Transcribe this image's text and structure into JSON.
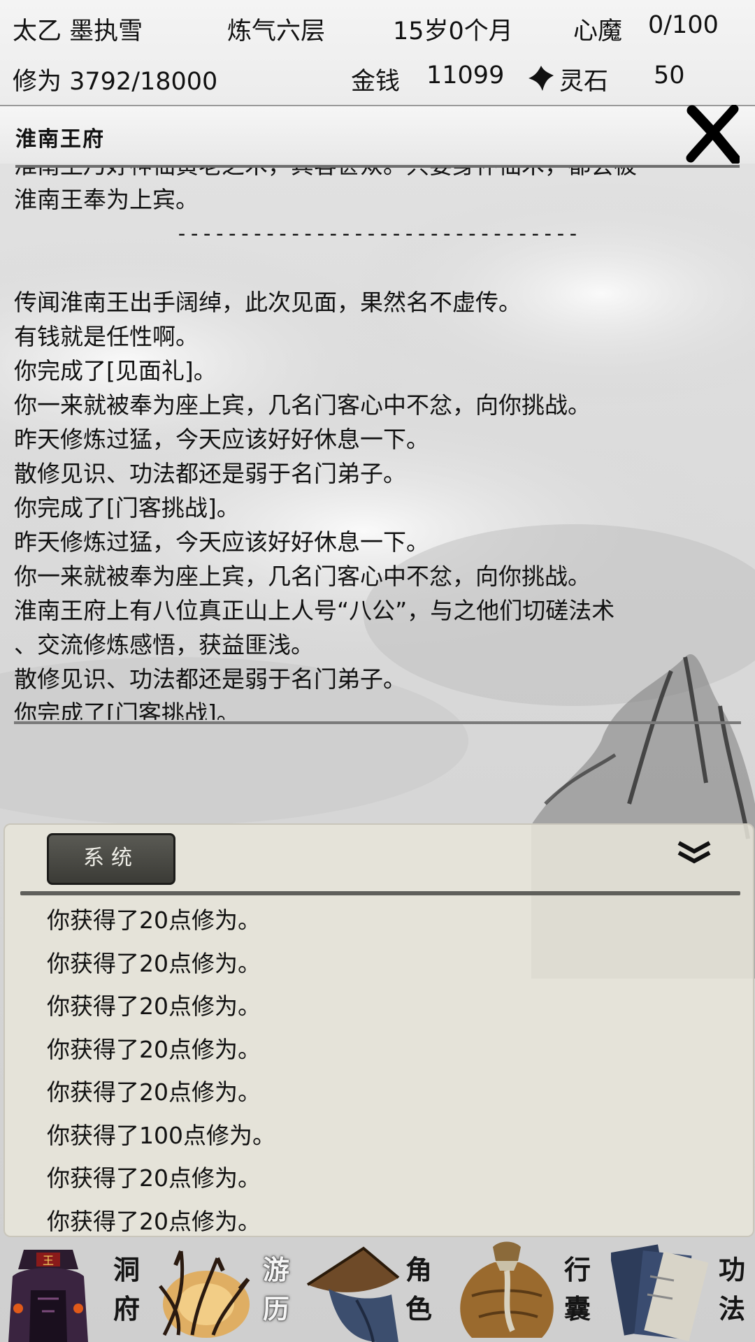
{
  "header": {
    "name": "太乙 墨执雪",
    "realm": "炼气六层",
    "age": "15岁0个月",
    "demon_label": "心魔",
    "demon_value": "0/100",
    "cultivation": "修为 3792/18000",
    "money_label": "金钱",
    "money_value": "11099",
    "stone_label": "灵石",
    "stone_value": "50",
    "icons": {
      "stone": "spirit-stone-icon"
    }
  },
  "event": {
    "title": "淮南王府",
    "close_icon": "close-x-icon",
    "lines": [
      "淮南王乃好神仙黄老之术，宾客甚众。只要身怀仙术，都会被",
      "淮南王奉为上宾。",
      "--------------------------------",
      "",
      "传闻淮南王出手阔绰，此次见面，果然名不虚传。",
      "有钱就是任性啊。",
      "你完成了[见面礼]。",
      "你一来就被奉为座上宾，几名门客心中不忿，向你挑战。",
      "昨天修炼过猛，今天应该好好休息一下。",
      "散修见识、功法都还是弱于名门弟子。",
      "你完成了[门客挑战]。",
      "昨天修炼过猛，今天应该好好休息一下。",
      "你一来就被奉为座上宾，几名门客心中不忿，向你挑战。",
      "淮南王府上有八位真正山上人号“八公”，与之他们切磋法术",
      "、交流修炼感悟，获益匪浅。",
      "散修见识、功法都还是弱于名门弟子。",
      "你完成了[门客挑战]。"
    ]
  },
  "log": {
    "tab_label": "系统",
    "collapse_icon": "double-chevron-down-icon",
    "lines": [
      "你获得了20点修为。",
      "你获得了20点修为。",
      "你获得了20点修为。",
      "你获得了20点修为。",
      "你获得了20点修为。",
      "你获得了100点修为。",
      "你获得了20点修为。",
      "你获得了20点修为。"
    ]
  },
  "nav": [
    {
      "label_top": "洞",
      "label_bottom": "府",
      "icon": "cave-mansion-icon",
      "active": false
    },
    {
      "label_top": "游",
      "label_bottom": "历",
      "icon": "travel-reeds-icon",
      "active": true
    },
    {
      "label_top": "角",
      "label_bottom": "色",
      "icon": "straw-hat-character-icon",
      "active": false
    },
    {
      "label_top": "行",
      "label_bottom": "囊",
      "icon": "bag-icon",
      "active": false
    },
    {
      "label_top": "功",
      "label_bottom": "法",
      "icon": "scroll-books-icon",
      "active": false
    }
  ],
  "colors": {
    "ink": "#111111",
    "panel": "#e8e5da",
    "tab": "#44443f",
    "active_glow": "#e0a040"
  }
}
